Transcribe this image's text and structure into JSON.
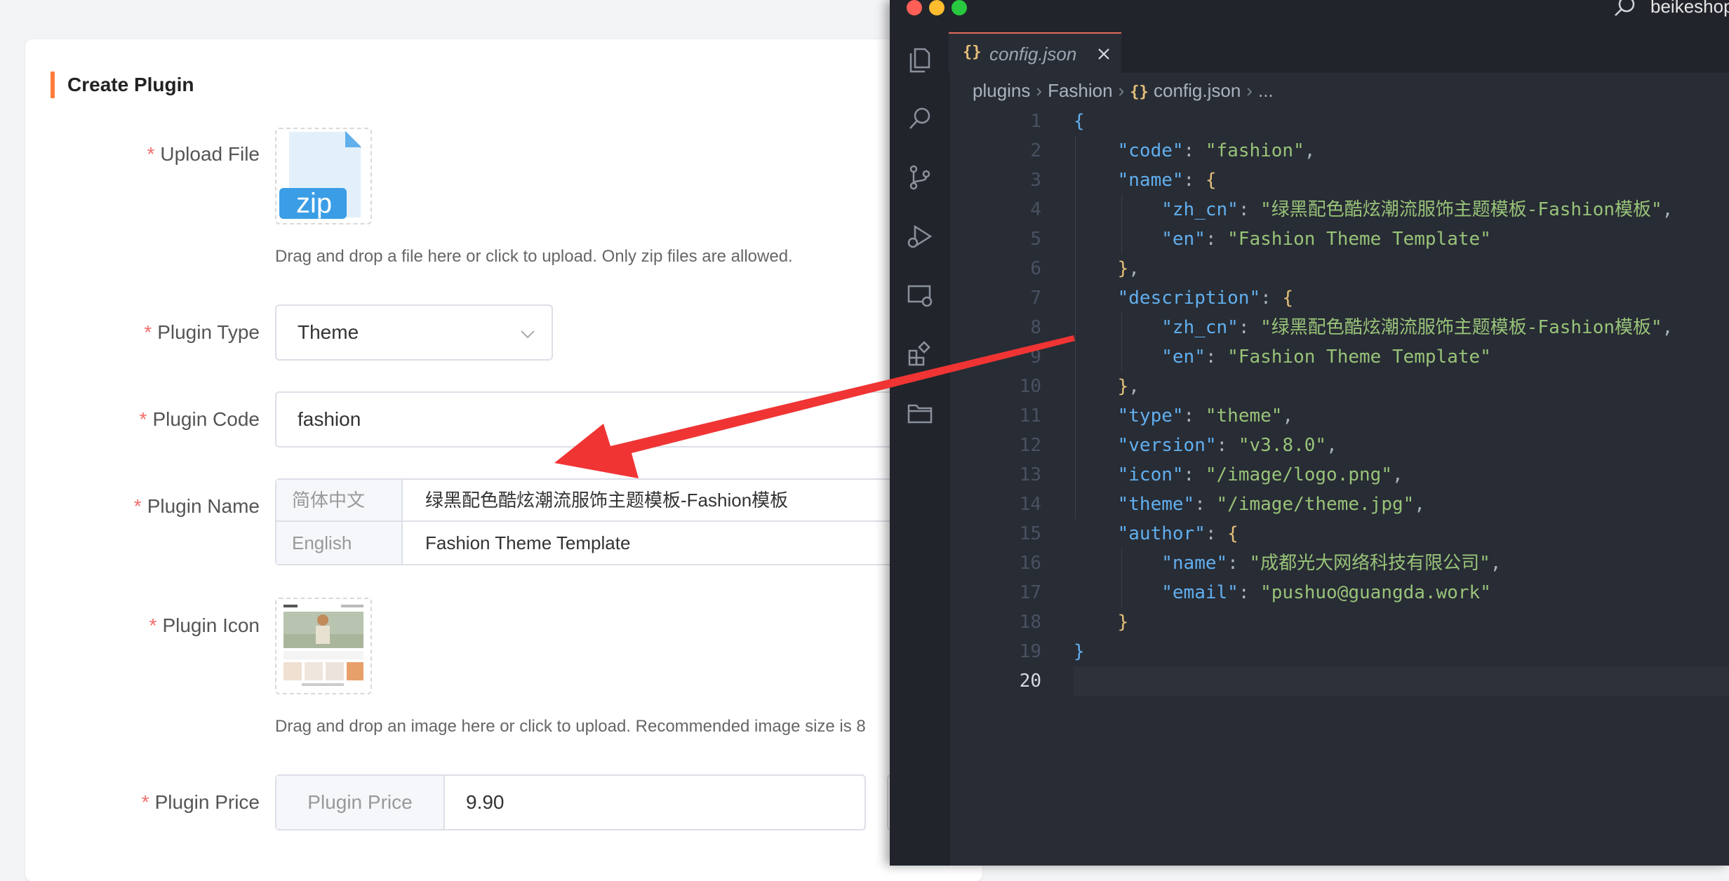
{
  "form": {
    "title": "Create Plugin",
    "required_mark": "*",
    "upload_file": {
      "label": "Upload File",
      "badge": "zip",
      "help": "Drag and drop a file here or click to upload. Only zip files are allowed."
    },
    "plugin_type": {
      "label": "Plugin Type",
      "value": "Theme"
    },
    "plugin_code": {
      "label": "Plugin Code",
      "value": "fashion"
    },
    "plugin_name": {
      "label": "Plugin Name",
      "rows": [
        {
          "lang": "简体中文",
          "value": "绿黑配色酷炫潮流服饰主题模板-Fashion模板"
        },
        {
          "lang": "English",
          "value": "Fashion Theme Template"
        }
      ]
    },
    "plugin_icon": {
      "label": "Plugin Icon",
      "help": "Drag and drop an image here or click to upload. Recommended image size is 8"
    },
    "plugin_price": {
      "label": "Plugin Price",
      "prefix": "Plugin Price",
      "value": "9.90"
    }
  },
  "editor": {
    "window_title": "beikeshop",
    "tab": {
      "label": "config.json",
      "icon": "{}"
    },
    "breadcrumb": [
      "plugins",
      "Fashion",
      "config.json",
      "..."
    ],
    "line_numbers": [
      "1",
      "2",
      "3",
      "4",
      "5",
      "6",
      "7",
      "8",
      "9",
      "10",
      "11",
      "12",
      "13",
      "14",
      "15",
      "16",
      "17",
      "18",
      "19",
      "20"
    ],
    "code": {
      "l1": "{",
      "l2_key": "\"code\"",
      "l2_val": "\"fashion\"",
      "l3_key": "\"name\"",
      "l3_brace": "{",
      "l4_key": "\"zh_cn\"",
      "l4_val": "\"绿黑配色酷炫潮流服饰主题模板-Fashion模板\"",
      "l5_key": "\"en\"",
      "l5_val": "\"Fashion Theme Template\"",
      "l6": "}",
      "l7_key": "\"description\"",
      "l7_brace": "{",
      "l8_key": "\"zh_cn\"",
      "l8_val": "\"绿黑配色酷炫潮流服饰主题模板-Fashion模板\"",
      "l9_key": "\"en\"",
      "l9_val": "\"Fashion Theme Template\"",
      "l10": "}",
      "l11_key": "\"type\"",
      "l11_val": "\"theme\"",
      "l12_key": "\"version\"",
      "l12_val": "\"v3.8.0\"",
      "l13_key": "\"icon\"",
      "l13_val": "\"/image/logo.png\"",
      "l14_key": "\"theme\"",
      "l14_val": "\"/image/theme.jpg\"",
      "l15_key": "\"author\"",
      "l15_brace": "{",
      "l16_key": "\"name\"",
      "l16_val": "\"成都光大网络科技有限公司\"",
      "l17_key": "\"email\"",
      "l17_val": "\"pushuo@guangda.work\"",
      "l18": "}",
      "l19": "}"
    }
  },
  "colors": {
    "accent": "#fd7e3c",
    "required": "#f56c6c",
    "arrow": "#f03434",
    "editor_bg": "#282c34",
    "json_key": "#61afef",
    "json_string": "#98c379"
  }
}
